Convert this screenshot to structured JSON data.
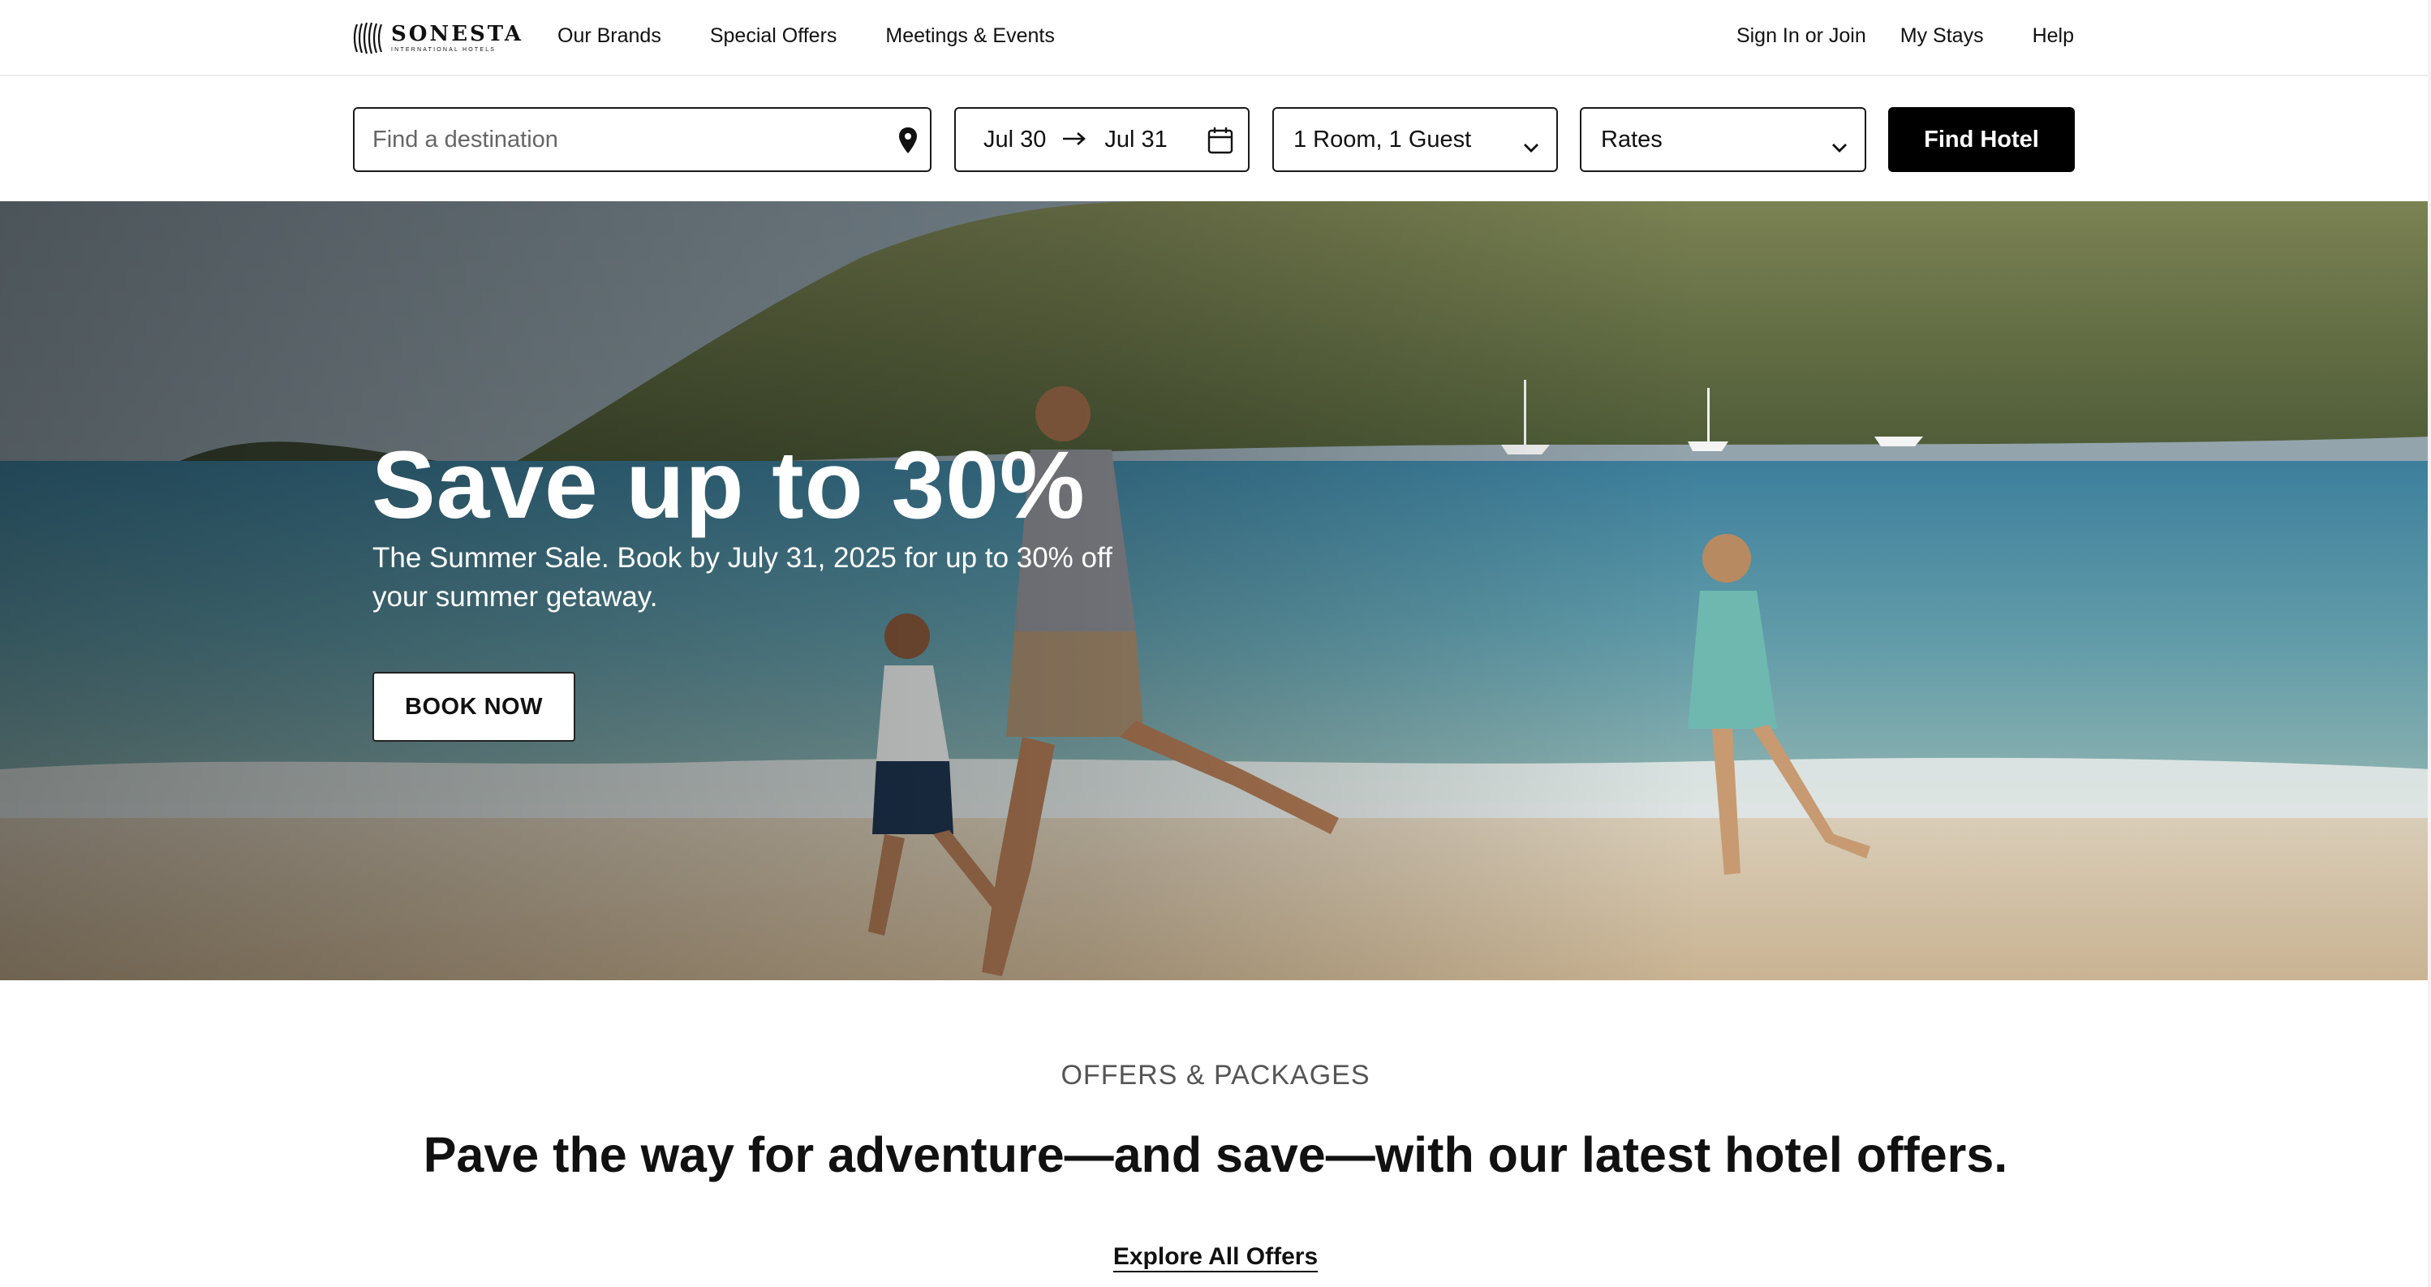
{
  "brand": {
    "logo_text": "SONESTA",
    "logo_subtext": "INTERNATIONAL HOTELS"
  },
  "nav": {
    "left": [
      "Our Brands",
      "Special Offers",
      "Meetings & Events"
    ],
    "sign_in": "Sign In or Join",
    "my_stays": "My Stays",
    "help": "Help"
  },
  "search": {
    "destination_placeholder": "Find a destination",
    "checkin": "Jul 30",
    "checkout": "Jul 31",
    "rooms_guests": "1 Room, 1 Guest",
    "rates": "Rates",
    "find_button": "Find Hotel"
  },
  "hero": {
    "title": "Save up to 30%",
    "subtitle": "The Summer Sale. Book by July 31, 2025 for up to 30% off your summer getaway.",
    "cta": "BOOK NOW"
  },
  "offers": {
    "eyebrow": "OFFERS & PACKAGES",
    "headline": "Pave the way for adventure—and save—with our latest hotel offers.",
    "link": "Explore All Offers"
  },
  "icons": {
    "location": "map-pin-icon",
    "calendar": "calendar-icon",
    "arrow": "arrow-right-icon",
    "dropdown": "chevron-down-icon"
  },
  "colors": {
    "primary": "#000000",
    "background": "#ffffff",
    "muted_text": "#555555"
  }
}
